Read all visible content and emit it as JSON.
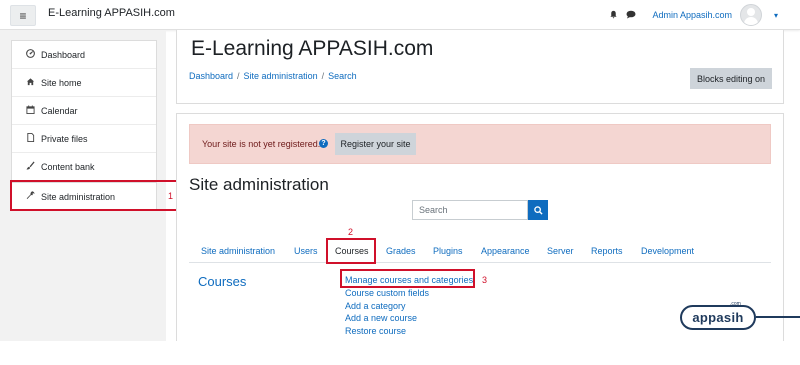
{
  "navbar": {
    "menu_icon": "hamburger-icon",
    "brand": "E-Learning APPASIH.com",
    "bell_icon": "bell-icon",
    "message_icon": "chat-icon",
    "user_name": "Admin Appasih.com",
    "caret": "▾"
  },
  "sidebar": {
    "items": [
      {
        "label": "Dashboard",
        "icon": "dashboard-icon"
      },
      {
        "label": "Site home",
        "icon": "home-icon"
      },
      {
        "label": "Calendar",
        "icon": "calendar-icon"
      },
      {
        "label": "Private files",
        "icon": "file-icon"
      },
      {
        "label": "Content bank",
        "icon": "paint-icon"
      }
    ],
    "admin": {
      "label": "Site administration",
      "icon": "wrench-icon"
    }
  },
  "header": {
    "title": "E-Learning APPASIH.com",
    "breadcrumb": [
      "Dashboard",
      "Site administration",
      "Search"
    ],
    "separator": "/",
    "edit_button": "Blocks editing on"
  },
  "alert": {
    "text": "Your site is not yet registered.",
    "button": "Register your site"
  },
  "admin_page": {
    "title": "Site administration",
    "search_placeholder": "Search",
    "tabs": [
      "Site administration",
      "Users",
      "Courses",
      "Grades",
      "Plugins",
      "Appearance",
      "Server",
      "Reports",
      "Development"
    ],
    "active_tab": "Courses",
    "section_heading": "Courses",
    "links": [
      "Manage courses and categories",
      "Course custom fields",
      "Add a category",
      "Add a new course",
      "Restore course"
    ]
  },
  "annotations": [
    "1",
    "2",
    "3"
  ],
  "watermark": {
    "text": "appasih",
    "sub": ".com"
  },
  "colors": {
    "accent": "#0f6cbf",
    "alert_bg": "#f4d6d2",
    "annotation": "#d0102a"
  }
}
